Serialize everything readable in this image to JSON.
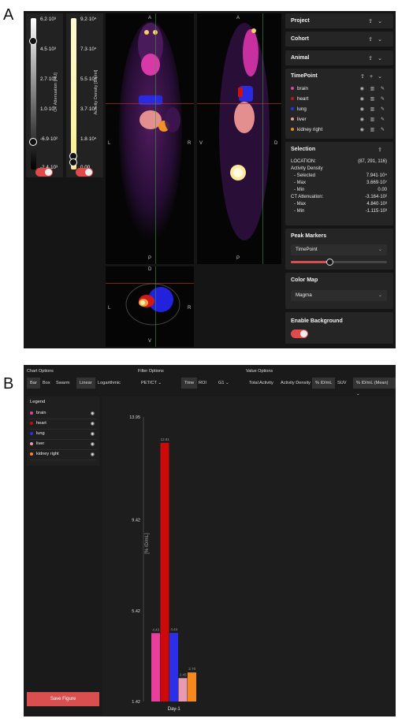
{
  "figure_labels": {
    "a": "A",
    "b": "B"
  },
  "colorbars": {
    "ct": {
      "ticks": [
        "6.2·10³",
        "4.5·10³",
        "2.7·10³",
        "1.0·10³",
        "-6.9·10²",
        "-2.4·10³"
      ],
      "axis_label": "CT Attenuation [HU]",
      "handle_levels": [
        0.84,
        0.17
      ],
      "enabled": true
    },
    "activity": {
      "ticks": [
        "9.2·10⁴",
        "7.3·10⁴",
        "5.5·10⁴",
        "3.7·10⁴",
        "1.8·10⁴",
        "0.00"
      ],
      "axis_label": "Activity Density [Bq/ml]",
      "handle_levels": [
        0.06,
        0.02
      ],
      "enabled": true
    }
  },
  "viewer": {
    "coronal": {
      "top": "A",
      "bottom": "P",
      "left": "L",
      "right": "R"
    },
    "sagittal": {
      "top": "A",
      "bottom": "P",
      "left": "V",
      "right": "D"
    },
    "axial": {
      "top": "D",
      "bottom": "V",
      "left": "L",
      "right": "R"
    }
  },
  "sidebar": {
    "project": "Project",
    "cohort": "Cohort",
    "animal": "Animal",
    "timepoint": {
      "title": "TimePoint",
      "rois": [
        {
          "name": "brain",
          "color": "#e040a0"
        },
        {
          "name": "heart",
          "color": "#cc1111"
        },
        {
          "name": "lung",
          "color": "#2233ee"
        },
        {
          "name": "liver",
          "color": "#e89aa0"
        },
        {
          "name": "kidney right",
          "color": "#f08a1c"
        }
      ]
    },
    "selection": {
      "title": "Selection",
      "location_label": "LOCATION:",
      "location_value": "(87, 291, 116)",
      "activity_label": "Activity Density",
      "activity_selected_label": "- Selected",
      "activity_selected": "7.941·10⁴",
      "activity_max_label": "- Max",
      "activity_max": "3.669·10⁷",
      "activity_min_label": "- Min",
      "activity_min": "0.00",
      "ct_label": "CT Attenuation:",
      "ct_value": "-3.164·10²",
      "ct_max_label": "- Max",
      "ct_max": "4.840·10³",
      "ct_min_label": "- Min",
      "ct_min": "-1.115·10³"
    },
    "peak_markers": {
      "title": "Peak Markers",
      "selected": "TimePoint",
      "slider_level": 0.4
    },
    "color_map": {
      "title": "Color Map",
      "selected": "Magma"
    },
    "background": {
      "title": "Enable Background",
      "enabled": true
    }
  },
  "chart_panel": {
    "chart_options": {
      "title": "Chart Options",
      "bar": "Bar",
      "box": "Box",
      "swarm": "Swarm",
      "linear": "Linear",
      "log": "Logarithmic"
    },
    "filter_options": {
      "title": "Filter Options",
      "modality": "PET/CT",
      "time": "Time",
      "roi": "ROI",
      "g": "G1"
    },
    "value_options": {
      "title": "Value Options",
      "total": "Total Activity",
      "density": "Activity Density",
      "pct_idml": "% ID/mL",
      "suv": "SUV",
      "agg": "% ID/mL (Mean)"
    },
    "legend_title": "Legend",
    "save_label": "Save Figure"
  },
  "chart_data": {
    "type": "bar",
    "categories": [
      "Day-1"
    ],
    "ylabel": "[% ID/mL]",
    "ylim": [
      1.42,
      13.95
    ],
    "yticks": [
      "13.95",
      "9.42",
      "5.42",
      "1.42"
    ],
    "series": [
      {
        "name": "brain",
        "color": "#e83e9c",
        "value": 4.43,
        "label": "4.43"
      },
      {
        "name": "heart",
        "color": "#cc0a0a",
        "value": 12.81,
        "label": "12.81"
      },
      {
        "name": "lung",
        "color": "#2b2fe8",
        "value": 4.44,
        "label": "4.44"
      },
      {
        "name": "liver",
        "color": "#e99ab0",
        "value": 2.45,
        "label": "2.45"
      },
      {
        "name": "kidney right",
        "color": "#f5891c",
        "value": 2.7,
        "label": "2.70"
      }
    ]
  }
}
